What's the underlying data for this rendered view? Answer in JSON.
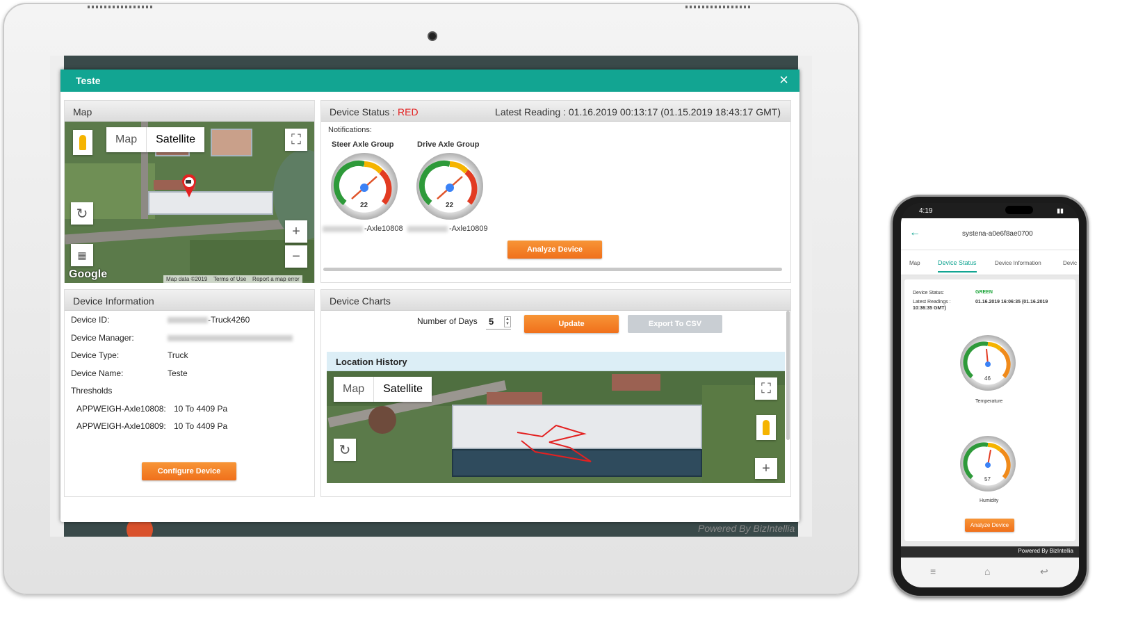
{
  "modal": {
    "title": "Teste",
    "close": "×"
  },
  "map_panel": {
    "title": "Map",
    "map_btn": "Map",
    "satellite_btn": "Satellite",
    "google": "Google",
    "attrib_data": "Map data ©2019",
    "attrib_terms": "Terms of Use",
    "attrib_report": "Report a map error"
  },
  "status_panel": {
    "title": "Device Status : ",
    "status": "RED",
    "latest": "Latest Reading : 01.16.2019 00:13:17 (01.15.2019 18:43:17 GMT)",
    "notifications": "Notifications:",
    "gauges": [
      {
        "title": "Steer Axle Group",
        "value": "22",
        "label": "-Axle10808"
      },
      {
        "title": "Drive Axle Group",
        "value": "22",
        "label": "-Axle10809"
      }
    ],
    "analyze": "Analyze Device"
  },
  "info_panel": {
    "title": "Device Information",
    "id_label": "Device ID:",
    "id_value": "-Truck4260",
    "manager_label": "Device Manager:",
    "type_label": "Device Type:",
    "type_value": "Truck",
    "name_label": "Device Name:",
    "name_value": "Teste",
    "thresholds_label": "Thresholds",
    "thresholds": [
      {
        "name": "APPWEIGH-Axle10808:",
        "value": "10 To 4409 Pa"
      },
      {
        "name": "APPWEIGH-Axle10809:",
        "value": "10 To 4409 Pa"
      }
    ],
    "configure": "Configure Device"
  },
  "charts_panel": {
    "title": "Device Charts",
    "days_label": "Number of Days",
    "days_value": "5",
    "update": "Update",
    "export": "Export To CSV",
    "location_title": "Location History",
    "map_btn": "Map",
    "satellite_btn": "Satellite"
  },
  "tablet_footer": {
    "powered": "Powered By BizIntellia"
  },
  "phone": {
    "time": "4:19",
    "device_title": "systena-a0e6f8ae0700",
    "tabs": [
      "Map",
      "Device Status",
      "Device Information",
      "Devic"
    ],
    "status_label": "Device Status:",
    "status_value": "GREEN",
    "readings_label": "Latest Readings :",
    "readings_value": "01.16.2019 16:06:35 (01.16.2019",
    "readings_value2": "10:36:35 GMT)",
    "gauges": [
      {
        "label": "Temperature",
        "value": "46"
      },
      {
        "label": "Humidity",
        "value": "57"
      }
    ],
    "analyze": "Analyze Device",
    "powered": "Powered By BizIntellia"
  },
  "colors": {
    "teal": "#12a592",
    "orange": "#f0701b",
    "red_status": "#e32121",
    "green_status": "#1ca53a"
  }
}
